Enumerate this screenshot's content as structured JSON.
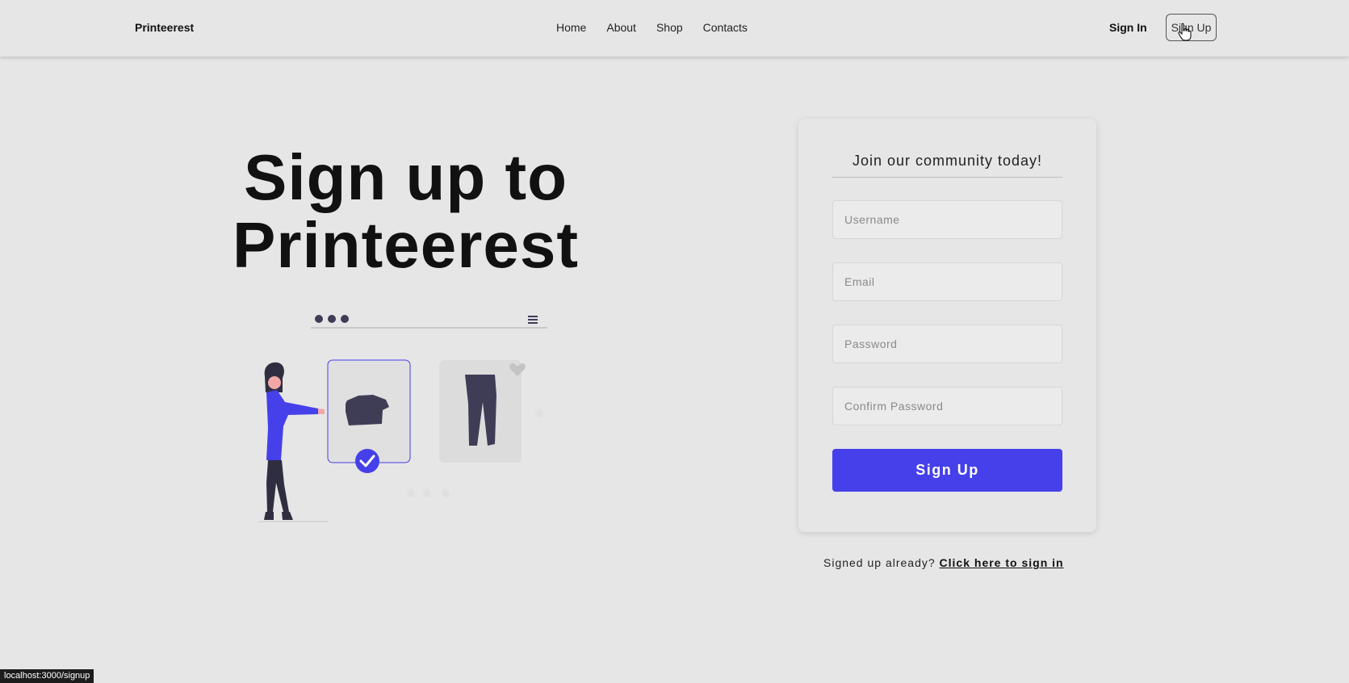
{
  "nav": {
    "brand": "Printeerest",
    "links": [
      "Home",
      "About",
      "Shop",
      "Contacts"
    ],
    "signin": "Sign In",
    "signup": "Sign Up"
  },
  "hero": {
    "line1": "Sign up to",
    "line2": "Printeerest"
  },
  "form": {
    "title": "Join our community today!",
    "username_placeholder": "Username",
    "email_placeholder": "Email",
    "password_placeholder": "Password",
    "confirm_placeholder": "Confirm Password",
    "submit_label": "Sign Up"
  },
  "footer": {
    "prompt": "Signed up already?",
    "link": "Click here to sign in"
  },
  "status_bar": "localhost:3000/signup",
  "colors": {
    "accent": "#4540e9",
    "background": "#e6e6e6",
    "text": "#111111"
  },
  "icons": [
    "cursor-hand-icon",
    "checkmark-icon",
    "heart-icon",
    "menu-icon"
  ]
}
